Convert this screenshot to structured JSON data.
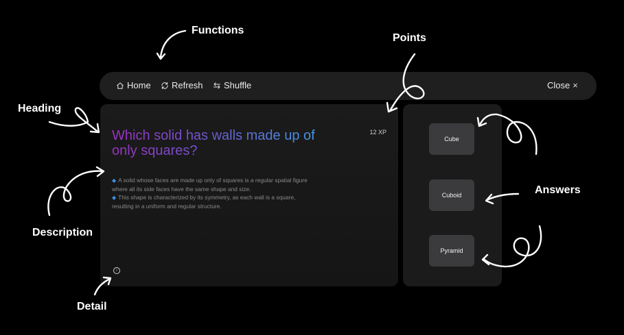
{
  "annotations": {
    "functions": "Functions",
    "points": "Points",
    "heading": "Heading",
    "answers": "Answers",
    "description": "Description",
    "detail": "Detail"
  },
  "toolbar": {
    "home": {
      "label": "Home",
      "icon": "home-icon"
    },
    "refresh": {
      "label": "Refresh",
      "icon": "refresh-icon"
    },
    "shuffle": {
      "label": "Shuffle",
      "icon": "shuffle-icon"
    },
    "close": {
      "label": "Close",
      "icon": "close-icon"
    }
  },
  "question": {
    "heading": "Which solid has walls made up of only squares?",
    "points": "12 XP",
    "description": [
      "A solid whose faces are made up only of squares is a regular spatial figure where all its side faces have the same shape and size.",
      "This shape is characterized by its symmetry, as each wall is a square, resulting in a uniform and regular structure."
    ],
    "detail_icon": "info-icon"
  },
  "answers": [
    "Cube",
    "Cuboid",
    "Pyramid"
  ],
  "colors": {
    "background": "#000000",
    "toolbar": "#1f1f1f",
    "card": "#1b1b1b",
    "answer_button": "#3b3b3d",
    "heading_gradient": [
      "#9b30c0",
      "#6a5bd0",
      "#3aa7e8"
    ],
    "bullet": "#3d8fe0"
  }
}
